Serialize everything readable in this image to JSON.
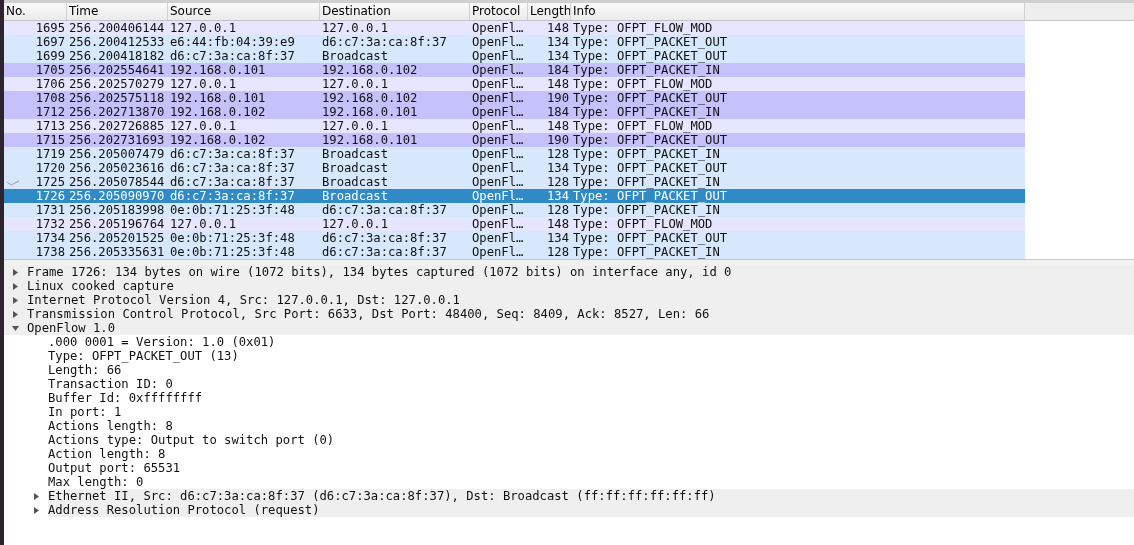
{
  "packet_list": {
    "columns": [
      "No.",
      "Time",
      "Source",
      "Destination",
      "Protocol",
      "Length",
      "Info"
    ],
    "rows": [
      {
        "cells": [
          "1695",
          "256.200406144",
          "127.0.0.1",
          "127.0.0.1",
          "OpenFl…",
          "148",
          "Type: OFPT_FLOW_MOD"
        ],
        "kind": "loopback",
        "selected": false,
        "related": false
      },
      {
        "cells": [
          "1697",
          "256.200412533",
          "e6:44:fb:04:39:e9",
          "d6:c7:3a:ca:8f:37",
          "OpenFl…",
          "134",
          "Type: OFPT_PACKET_OUT"
        ],
        "kind": "arp",
        "selected": false,
        "related": false
      },
      {
        "cells": [
          "1699",
          "256.200418182",
          "d6:c7:3a:ca:8f:37",
          "Broadcast",
          "OpenFl…",
          "134",
          "Type: OFPT_PACKET_OUT"
        ],
        "kind": "arp",
        "selected": false,
        "related": false
      },
      {
        "cells": [
          "1705",
          "256.202554641",
          "192.168.0.101",
          "192.168.0.102",
          "OpenFl…",
          "184",
          "Type: OFPT_PACKET_IN"
        ],
        "kind": "icmp",
        "selected": false,
        "related": false
      },
      {
        "cells": [
          "1706",
          "256.202570279",
          "127.0.0.1",
          "127.0.0.1",
          "OpenFl…",
          "148",
          "Type: OFPT_FLOW_MOD"
        ],
        "kind": "loopback",
        "selected": false,
        "related": false
      },
      {
        "cells": [
          "1708",
          "256.202575118",
          "192.168.0.101",
          "192.168.0.102",
          "OpenFl…",
          "190",
          "Type: OFPT_PACKET_OUT"
        ],
        "kind": "icmp",
        "selected": false,
        "related": false
      },
      {
        "cells": [
          "1712",
          "256.202713870",
          "192.168.0.102",
          "192.168.0.101",
          "OpenFl…",
          "184",
          "Type: OFPT_PACKET_IN"
        ],
        "kind": "icmp",
        "selected": false,
        "related": false
      },
      {
        "cells": [
          "1713",
          "256.202726885",
          "127.0.0.1",
          "127.0.0.1",
          "OpenFl…",
          "148",
          "Type: OFPT_FLOW_MOD"
        ],
        "kind": "loopback",
        "selected": false,
        "related": false
      },
      {
        "cells": [
          "1715",
          "256.202731693",
          "192.168.0.102",
          "192.168.0.101",
          "OpenFl…",
          "190",
          "Type: OFPT_PACKET_OUT"
        ],
        "kind": "icmp",
        "selected": false,
        "related": false
      },
      {
        "cells": [
          "1719",
          "256.205007479",
          "d6:c7:3a:ca:8f:37",
          "Broadcast",
          "OpenFl…",
          "128",
          "Type: OFPT_PACKET_IN"
        ],
        "kind": "arp",
        "selected": false,
        "related": false
      },
      {
        "cells": [
          "1720",
          "256.205023616",
          "d6:c7:3a:ca:8f:37",
          "Broadcast",
          "OpenFl…",
          "134",
          "Type: OFPT_PACKET_OUT"
        ],
        "kind": "arp",
        "selected": false,
        "related": false
      },
      {
        "cells": [
          "1725",
          "256.205078544",
          "d6:c7:3a:ca:8f:37",
          "Broadcast",
          "OpenFl…",
          "128",
          "Type: OFPT_PACKET_IN"
        ],
        "kind": "arp",
        "selected": false,
        "related": true
      },
      {
        "cells": [
          "1726",
          "256.205090970",
          "d6:c7:3a:ca:8f:37",
          "Broadcast",
          "OpenFl…",
          "134",
          "Type: OFPT_PACKET_OUT"
        ],
        "selected": true,
        "related": false
      },
      {
        "cells": [
          "1731",
          "256.205183998",
          "0e:0b:71:25:3f:48",
          "d6:c7:3a:ca:8f:37",
          "OpenFl…",
          "128",
          "Type: OFPT_PACKET_IN"
        ],
        "kind": "arp",
        "selected": false,
        "related": false
      },
      {
        "cells": [
          "1732",
          "256.205196764",
          "127.0.0.1",
          "127.0.0.1",
          "OpenFl…",
          "148",
          "Type: OFPT_FLOW_MOD"
        ],
        "kind": "loopback",
        "selected": false,
        "related": false
      },
      {
        "cells": [
          "1734",
          "256.205201525",
          "0e:0b:71:25:3f:48",
          "d6:c7:3a:ca:8f:37",
          "OpenFl…",
          "134",
          "Type: OFPT_PACKET_OUT"
        ],
        "kind": "arp",
        "selected": false,
        "related": false
      },
      {
        "cells": [
          "1738",
          "256.205335631",
          "0e:0b:71:25:3f:48",
          "d6:c7:3a:ca:8f:37",
          "OpenFl…",
          "128",
          "Type: OFPT_PACKET_IN"
        ],
        "kind": "arp",
        "selected": false,
        "related": false
      }
    ]
  },
  "packet_details": [
    {
      "label": "Frame 1726: 134 bytes on wire (1072 bits), 134 bytes captured (1072 bits) on interface any, id 0",
      "expanded": false
    },
    {
      "label": "Linux cooked capture",
      "expanded": false
    },
    {
      "label": "Internet Protocol Version 4, Src: 127.0.0.1, Dst: 127.0.0.1",
      "expanded": false
    },
    {
      "label": "Transmission Control Protocol, Src Port: 6633, Dst Port: 48400, Seq: 8409, Ack: 8527, Len: 66",
      "expanded": false
    },
    {
      "label": "OpenFlow 1.0",
      "expanded": true,
      "children": [
        {
          "label": ".000 0001 = Version: 1.0 (0x01)"
        },
        {
          "label": "Type: OFPT_PACKET_OUT (13)"
        },
        {
          "label": "Length: 66"
        },
        {
          "label": "Transaction ID: 0"
        },
        {
          "label": "Buffer Id: 0xffffffff"
        },
        {
          "label": "In port: 1"
        },
        {
          "label": "Actions length: 8"
        },
        {
          "label": "Actions type: Output to switch port (0)"
        },
        {
          "label": "Action length: 8"
        },
        {
          "label": "Output port: 65531"
        },
        {
          "label": "Max length: 0"
        },
        {
          "label": "Ethernet II, Src: d6:c7:3a:ca:8f:37 (d6:c7:3a:ca:8f:37), Dst: Broadcast (ff:ff:ff:ff:ff:ff)",
          "expanded": false
        },
        {
          "label": "Address Resolution Protocol (request)",
          "expanded": false
        }
      ]
    }
  ]
}
